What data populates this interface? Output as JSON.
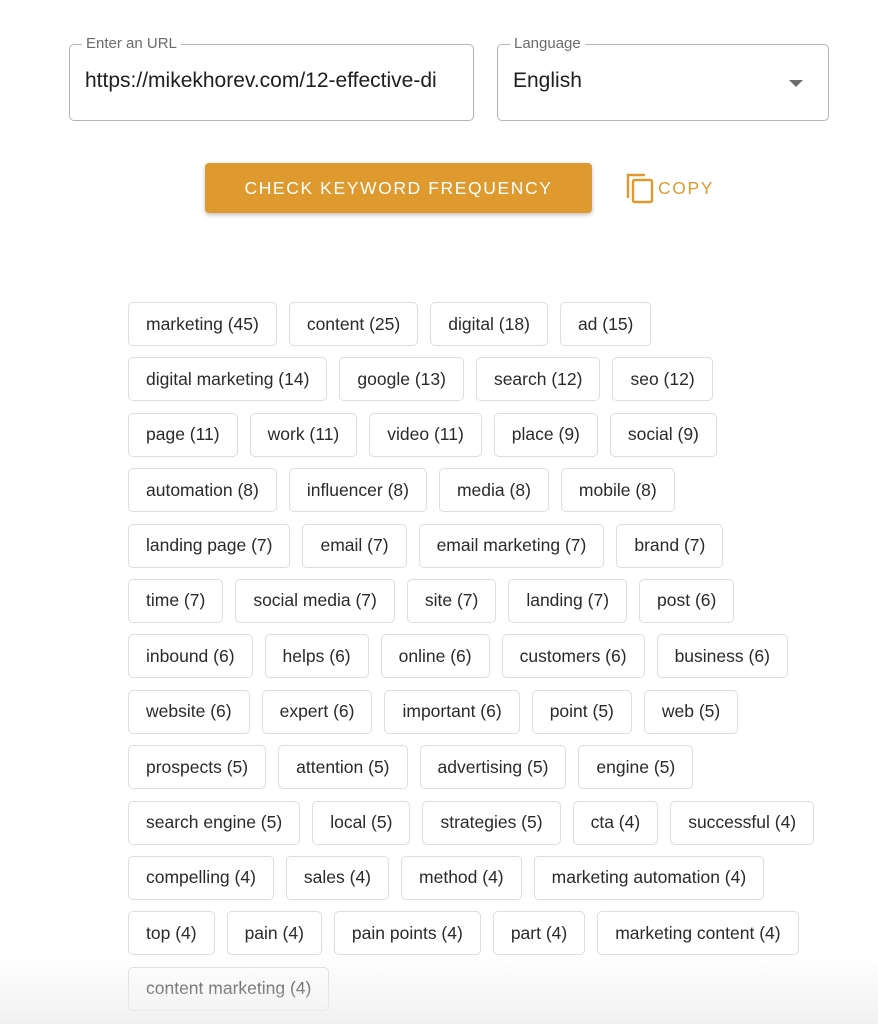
{
  "form": {
    "url_field": {
      "label": "Enter an URL",
      "value": "https://mikekhorev.com/12-effective-di"
    },
    "language_field": {
      "label": "Language",
      "selected": "English",
      "icon": "dropdown-arrow-icon"
    }
  },
  "actions": {
    "check_label": "CHECK KEYWORD FREQUENCY",
    "copy_label": "COPY",
    "copy_icon": "copy-icon"
  },
  "colors": {
    "accent": "#df9a2f",
    "chip_border": "#dddddd",
    "field_border": "#b5b5b5"
  },
  "keywords": [
    {
      "word": "marketing",
      "count": 45
    },
    {
      "word": "content",
      "count": 25
    },
    {
      "word": "digital",
      "count": 18
    },
    {
      "word": "ad",
      "count": 15
    },
    {
      "word": "digital marketing",
      "count": 14
    },
    {
      "word": "google",
      "count": 13
    },
    {
      "word": "search",
      "count": 12
    },
    {
      "word": "seo",
      "count": 12
    },
    {
      "word": "page",
      "count": 11
    },
    {
      "word": "work",
      "count": 11
    },
    {
      "word": "video",
      "count": 11
    },
    {
      "word": "place",
      "count": 9
    },
    {
      "word": "social",
      "count": 9
    },
    {
      "word": "automation",
      "count": 8
    },
    {
      "word": "influencer",
      "count": 8
    },
    {
      "word": "media",
      "count": 8
    },
    {
      "word": "mobile",
      "count": 8
    },
    {
      "word": "landing page",
      "count": 7
    },
    {
      "word": "email",
      "count": 7
    },
    {
      "word": "email marketing",
      "count": 7
    },
    {
      "word": "brand",
      "count": 7
    },
    {
      "word": "time",
      "count": 7
    },
    {
      "word": "social media",
      "count": 7
    },
    {
      "word": "site",
      "count": 7
    },
    {
      "word": "landing",
      "count": 7
    },
    {
      "word": "post",
      "count": 6
    },
    {
      "word": "inbound",
      "count": 6
    },
    {
      "word": "helps",
      "count": 6
    },
    {
      "word": "online",
      "count": 6
    },
    {
      "word": "customers",
      "count": 6
    },
    {
      "word": "business",
      "count": 6
    },
    {
      "word": "website",
      "count": 6
    },
    {
      "word": "expert",
      "count": 6
    },
    {
      "word": "important",
      "count": 6
    },
    {
      "word": "point",
      "count": 5
    },
    {
      "word": "web",
      "count": 5
    },
    {
      "word": "prospects",
      "count": 5
    },
    {
      "word": "attention",
      "count": 5
    },
    {
      "word": "advertising",
      "count": 5
    },
    {
      "word": "engine",
      "count": 5
    },
    {
      "word": "search engine",
      "count": 5
    },
    {
      "word": "local",
      "count": 5
    },
    {
      "word": "strategies",
      "count": 5
    },
    {
      "word": "cta",
      "count": 4
    },
    {
      "word": "successful",
      "count": 4
    },
    {
      "word": "compelling",
      "count": 4
    },
    {
      "word": "sales",
      "count": 4
    },
    {
      "word": "method",
      "count": 4
    },
    {
      "word": "marketing automation",
      "count": 4
    },
    {
      "word": "top",
      "count": 4
    },
    {
      "word": "pain",
      "count": 4
    },
    {
      "word": "pain points",
      "count": 4
    },
    {
      "word": "part",
      "count": 4
    },
    {
      "word": "marketing content",
      "count": 4
    },
    {
      "word": "content marketing",
      "count": 4
    }
  ]
}
